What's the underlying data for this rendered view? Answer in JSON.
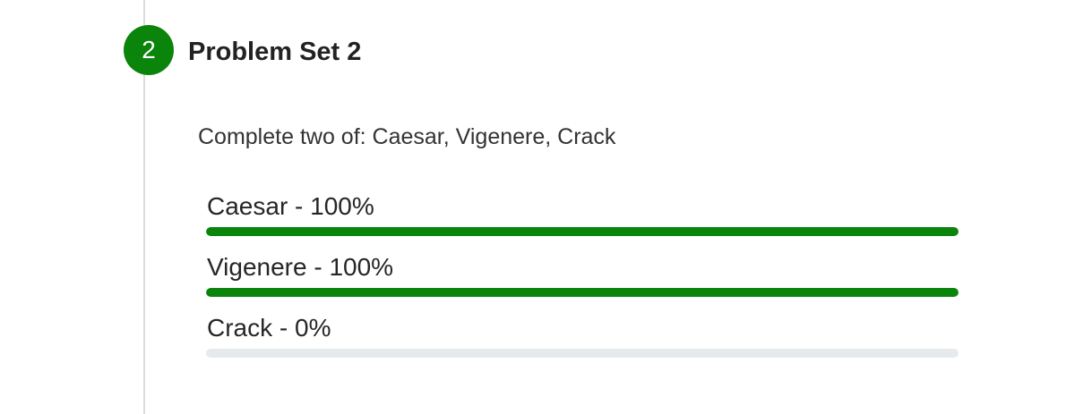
{
  "step": {
    "number": "2",
    "title": "Problem Set 2",
    "instructions": "Complete two of: Caesar, Vigenere, Crack"
  },
  "progress_items": [
    {
      "label": "Caesar - 100%",
      "value_percent": 100
    },
    {
      "label": "Vigenere - 100%",
      "value_percent": 100
    },
    {
      "label": "Crack - 0%",
      "value_percent": 0
    }
  ],
  "colors": {
    "accent": "#0a840a",
    "track": "#e6eaec",
    "timeline": "#dcdcdc"
  }
}
